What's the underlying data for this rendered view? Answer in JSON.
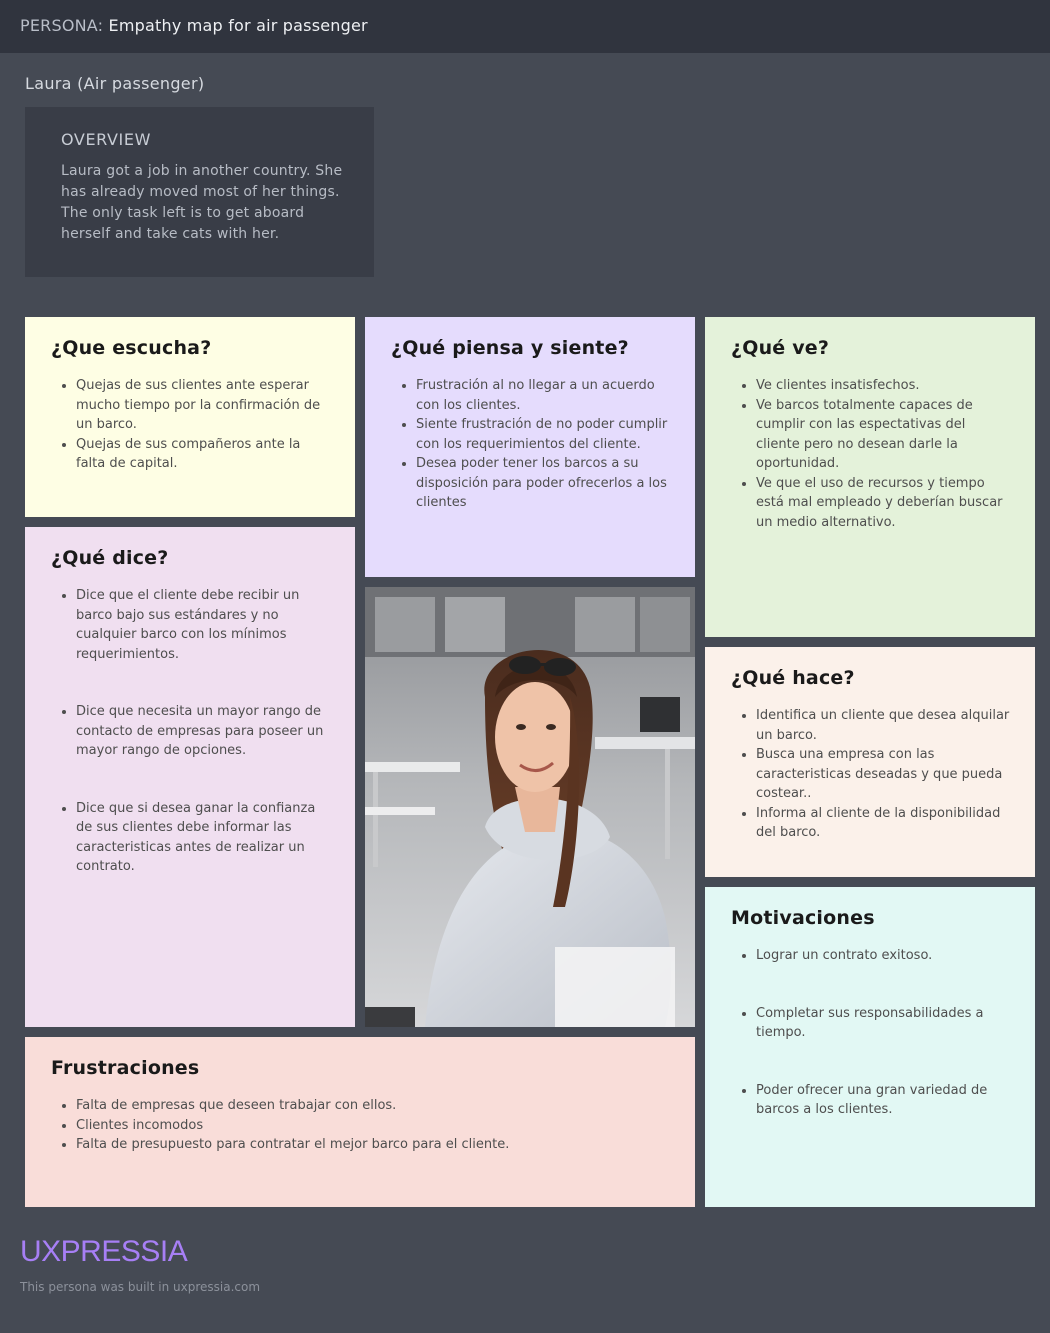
{
  "header": {
    "prefix": "PERSONA:",
    "title": "Empathy map for air passenger"
  },
  "persona": {
    "name": "Laura (Air passenger)"
  },
  "overview": {
    "heading": "OVERVIEW",
    "text": "Laura got a job in another country. She has already moved most of her things. The only task left is to get aboard herself and take cats with her."
  },
  "cards": {
    "escucha": {
      "title": "¿Que escucha?",
      "items": [
        "Quejas de sus clientes ante esperar mucho tiempo por la confirmación de un barco.",
        "Quejas de sus compañeros ante la falta de capital."
      ]
    },
    "piensa": {
      "title": "¿Qué piensa y siente?",
      "items": [
        "Frustración al no llegar a un acuerdo con los clientes.",
        "Siente frustración de no poder cumplir con los requerimientos del cliente.",
        "Desea poder tener los barcos a su disposición para poder ofrecerlos a los clientes"
      ]
    },
    "ve": {
      "title": "¿Qué ve?",
      "items": [
        "Ve clientes insatisfechos.",
        "Ve barcos totalmente capaces de cumplir con las espectativas del cliente pero no desean darle la oportunidad.",
        "Ve que el uso de recursos y tiempo está mal empleado y deberían buscar un medio alternativo."
      ]
    },
    "dice": {
      "title": "¿Qué dice?",
      "items": [
        "Dice que el cliente debe recibir un barco bajo sus estándares y no cualquier barco con los mínimos requerimientos.",
        "Dice que necesita un mayor rango de contacto de empresas para poseer un mayor rango de opciones.",
        "Dice que si desea ganar la confianza de sus clientes debe informar las caracteristicas antes de realizar un contrato."
      ]
    },
    "hace": {
      "title": "¿Qué hace?",
      "items": [
        "Identifica un cliente que desea alquilar un barco.",
        "Busca una empresa con las caracteristicas deseadas y que pueda costear..",
        "Informa al cliente de la disponibilidad del barco."
      ]
    },
    "motivaciones": {
      "title": "Motivaciones",
      "items": [
        "Lograr un contrato exitoso.",
        "Completar sus responsabilidades a tiempo.",
        "Poder ofrecer una gran variedad de barcos a los clientes."
      ]
    },
    "frustraciones": {
      "title": "Frustraciones",
      "items": [
        "Falta de empresas que deseen trabajar con ellos.",
        "Clientes incomodos",
        "Falta de presupuesto para contratar el mejor barco para el cliente."
      ]
    }
  },
  "footer": {
    "brand": "UXPRESSIA",
    "built_with": "This persona was built in uxpressia.com"
  }
}
